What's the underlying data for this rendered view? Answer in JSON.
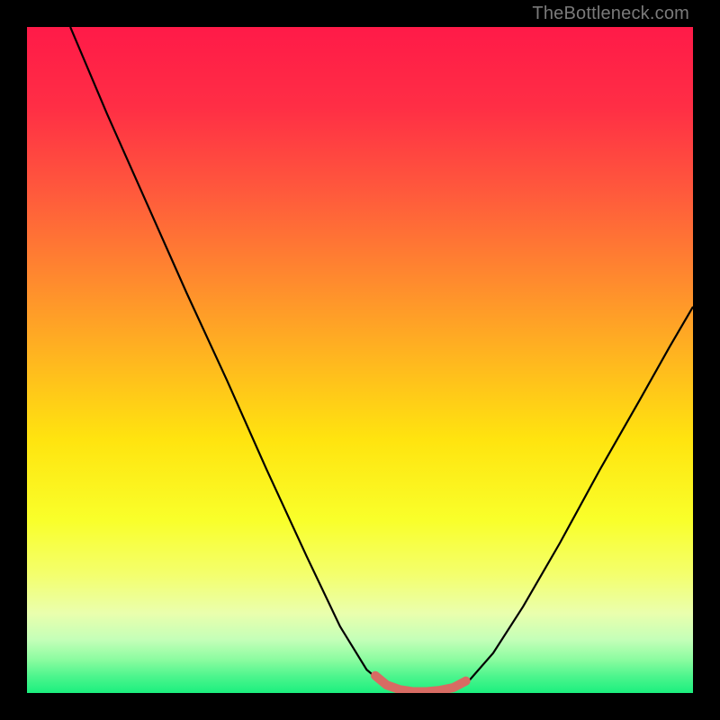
{
  "watermark": {
    "text": "TheBottleneck.com"
  },
  "chart_data": {
    "type": "line",
    "title": "",
    "xlabel": "",
    "ylabel": "",
    "xlim": [
      0.0,
      1.0
    ],
    "ylim": [
      0.0,
      1.0
    ],
    "bg_gradient_stops": [
      {
        "t": 0.0,
        "color": "#ff1a48"
      },
      {
        "t": 0.12,
        "color": "#ff2e45"
      },
      {
        "t": 0.25,
        "color": "#ff5a3c"
      },
      {
        "t": 0.38,
        "color": "#ff8a2e"
      },
      {
        "t": 0.5,
        "color": "#ffb71f"
      },
      {
        "t": 0.62,
        "color": "#ffe40f"
      },
      {
        "t": 0.74,
        "color": "#f9ff2a"
      },
      {
        "t": 0.82,
        "color": "#f4ff6b"
      },
      {
        "t": 0.88,
        "color": "#eaffad"
      },
      {
        "t": 0.92,
        "color": "#c4ffb8"
      },
      {
        "t": 0.95,
        "color": "#8bfca0"
      },
      {
        "t": 0.975,
        "color": "#4df58d"
      },
      {
        "t": 1.0,
        "color": "#1bef7e"
      }
    ],
    "series": [
      {
        "name": "bottleneck-curve",
        "color": "#000000",
        "width": 2.2,
        "points": [
          {
            "x": 0.065,
            "y": 1.0
          },
          {
            "x": 0.12,
            "y": 0.87
          },
          {
            "x": 0.18,
            "y": 0.735
          },
          {
            "x": 0.24,
            "y": 0.6
          },
          {
            "x": 0.3,
            "y": 0.47
          },
          {
            "x": 0.36,
            "y": 0.335
          },
          {
            "x": 0.42,
            "y": 0.205
          },
          {
            "x": 0.47,
            "y": 0.1
          },
          {
            "x": 0.51,
            "y": 0.035
          },
          {
            "x": 0.54,
            "y": 0.01
          },
          {
            "x": 0.56,
            "y": 0.003
          },
          {
            "x": 0.58,
            "y": 0.001
          },
          {
            "x": 0.6,
            "y": 0.001
          },
          {
            "x": 0.62,
            "y": 0.002
          },
          {
            "x": 0.64,
            "y": 0.006
          },
          {
            "x": 0.665,
            "y": 0.02
          },
          {
            "x": 0.7,
            "y": 0.06
          },
          {
            "x": 0.745,
            "y": 0.13
          },
          {
            "x": 0.8,
            "y": 0.225
          },
          {
            "x": 0.86,
            "y": 0.335
          },
          {
            "x": 0.92,
            "y": 0.44
          },
          {
            "x": 0.965,
            "y": 0.52
          },
          {
            "x": 1.0,
            "y": 0.58
          }
        ]
      },
      {
        "name": "valley-highlight",
        "color": "#d86b63",
        "width": 10,
        "cap": "round",
        "points": [
          {
            "x": 0.523,
            "y": 0.026
          },
          {
            "x": 0.54,
            "y": 0.012
          },
          {
            "x": 0.56,
            "y": 0.005
          },
          {
            "x": 0.58,
            "y": 0.002
          },
          {
            "x": 0.6,
            "y": 0.002
          },
          {
            "x": 0.62,
            "y": 0.004
          },
          {
            "x": 0.64,
            "y": 0.008
          },
          {
            "x": 0.659,
            "y": 0.018
          }
        ]
      }
    ]
  }
}
